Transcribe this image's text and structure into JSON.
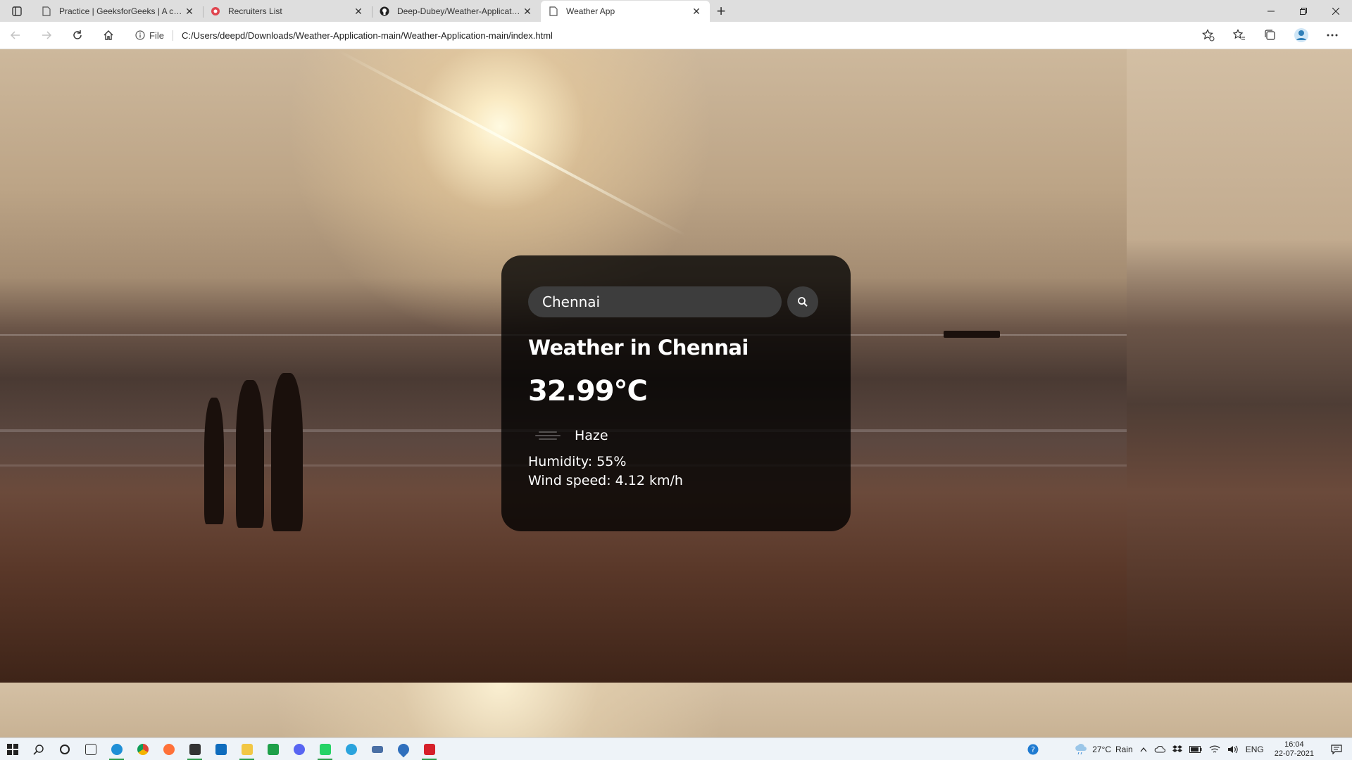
{
  "browser": {
    "tabs": [
      {
        "title": "Practice | GeeksforGeeks | A computer science portal for geeks",
        "favicon": "page-icon",
        "active": false
      },
      {
        "title": "Recruiters List",
        "favicon": "record-icon",
        "active": false
      },
      {
        "title": "Deep-Dubey/Weather-Application-main",
        "favicon": "github-icon",
        "active": false
      },
      {
        "title": "Weather App",
        "favicon": "page-icon",
        "active": true
      }
    ],
    "close_glyph": "✕",
    "new_tab_glyph": "+",
    "address": {
      "scheme_label": "File",
      "url": "C:/Users/deepd/Downloads/Weather-Application-main/Weather-Application-main/index.html"
    }
  },
  "weather": {
    "search": {
      "value": "Chennai",
      "placeholder": "Search"
    },
    "city_heading": "Weather in Chennai",
    "temperature": "32.99°C",
    "description": "Haze",
    "humidity": "Humidity: 55%",
    "wind": "Wind speed: 4.12 km/h"
  },
  "taskbar": {
    "weather_widget": {
      "temp": "27°C",
      "condition": "Rain"
    },
    "language": "ENG",
    "time": "16:04",
    "date": "22-07-2021",
    "apps": [
      {
        "name": "task-view-icon",
        "color": "#333333",
        "running": false
      },
      {
        "name": "edge-icon",
        "color": "#1f8fd6",
        "running": true
      },
      {
        "name": "chrome-icon",
        "color": "#db4437",
        "running": false
      },
      {
        "name": "firefox-icon",
        "color": "#ff7139",
        "running": false
      },
      {
        "name": "store-icon",
        "color": "#333333",
        "running": true
      },
      {
        "name": "mail-icon",
        "color": "#0f6cbd",
        "running": false
      },
      {
        "name": "file-explorer-icon",
        "color": "#f2c744",
        "running": true
      },
      {
        "name": "spreadsheet-icon",
        "color": "#1fa04a",
        "running": false
      },
      {
        "name": "discord-icon",
        "color": "#5865f2",
        "running": false
      },
      {
        "name": "whatsapp-icon",
        "color": "#25d366",
        "running": true
      },
      {
        "name": "telegram-icon",
        "color": "#2aa3dd",
        "running": false
      },
      {
        "name": "keyboard-icon",
        "color": "#4a6fa5",
        "running": false
      },
      {
        "name": "drop-icon",
        "color": "#2f6fbd",
        "running": false
      },
      {
        "name": "acrobat-icon",
        "color": "#d6202a",
        "running": true
      }
    ]
  }
}
